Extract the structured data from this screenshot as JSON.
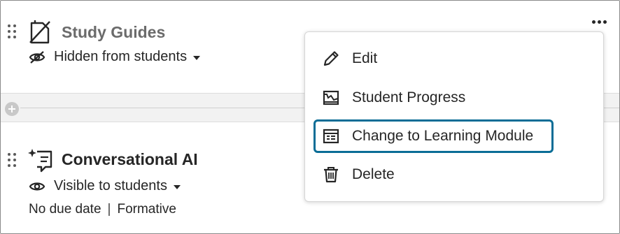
{
  "items": [
    {
      "title": "Study Guides",
      "visibility": "Hidden from students",
      "type_icon": "hidden-document-icon",
      "visibility_icon": "eye-slash-icon"
    },
    {
      "title": "Conversational AI",
      "visibility": "Visible to students",
      "due": "No due date",
      "separator": "|",
      "grading": "Formative",
      "type_icon": "conversational-ai-icon",
      "visibility_icon": "eye-icon"
    }
  ],
  "context_menu": {
    "items": [
      {
        "label": "Edit",
        "icon": "pencil-icon"
      },
      {
        "label": "Student Progress",
        "icon": "progress-icon"
      },
      {
        "label": "Change to Learning Module",
        "icon": "learning-module-icon",
        "focused": true
      },
      {
        "label": "Delete",
        "icon": "trash-icon"
      }
    ]
  },
  "colors": {
    "focus_ring": "#0a6d96",
    "text": "#262626",
    "muted_title": "#6b6b6b",
    "divider_band": "#f2f2f2"
  }
}
